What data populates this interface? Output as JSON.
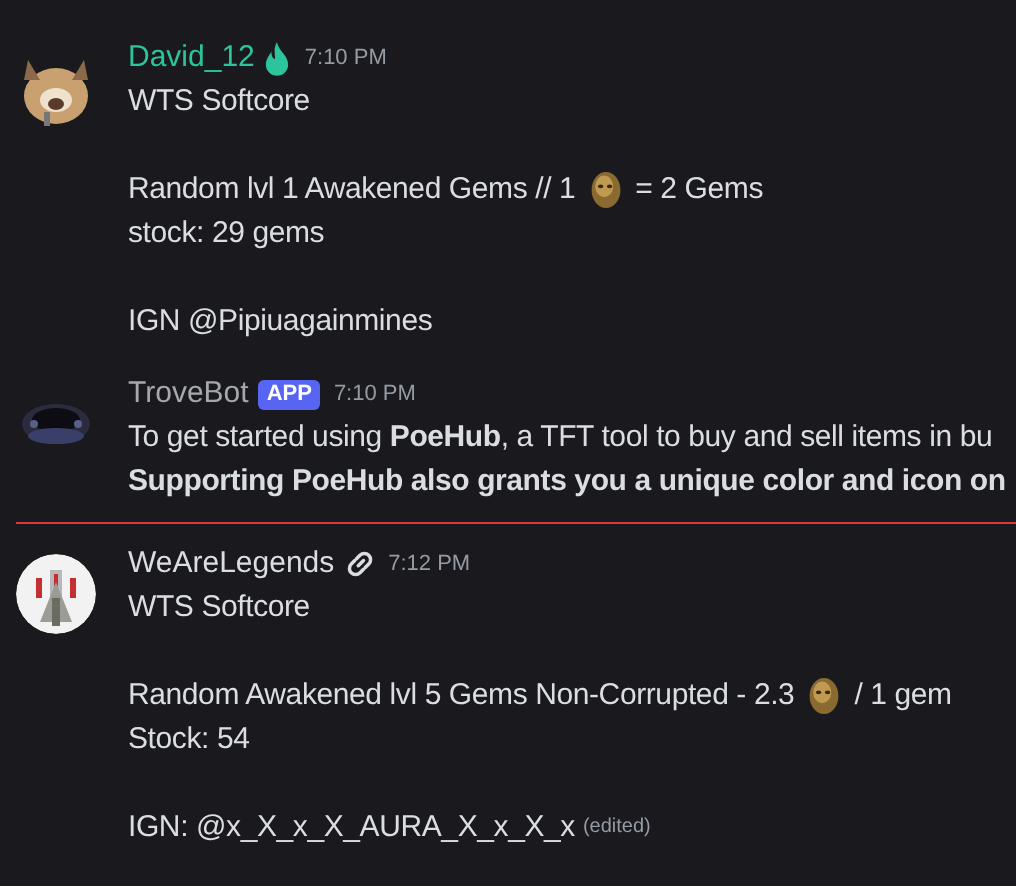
{
  "messages": [
    {
      "author": "David_12",
      "color": "#2bc49c",
      "kind": "flame",
      "time": "7:10 PM",
      "lines": [
        {
          "parts": [
            {
              "kind": "text",
              "text": "WTS Softcore"
            }
          ]
        },
        {
          "gap_before": true,
          "parts": [
            {
              "kind": "text",
              "text": "Random lvl 1 Awakened Gems // 1"
            },
            {
              "kind": "emoji"
            },
            {
              "kind": "text",
              "text": "= 2 Gems"
            }
          ]
        },
        {
          "parts": [
            {
              "kind": "text",
              "text": "stock: 29 gems"
            }
          ]
        },
        {
          "gap_before": true,
          "parts": [
            {
              "kind": "text",
              "text": "IGN @Pipiuagainmines"
            }
          ]
        }
      ]
    },
    {
      "author": "TroveBot",
      "color": "#a5a8ae",
      "kind": "app",
      "badge": "APP",
      "time": "7:10 PM",
      "lines": [
        {
          "parts": [
            {
              "kind": "text",
              "text": "To get started using **PoeHub**, a TFT tool to buy and sell items in bu"
            }
          ]
        },
        {
          "bold": true,
          "parts": [
            {
              "kind": "text",
              "text": "Supporting PoeHub also grants you a unique color and icon on"
            }
          ]
        }
      ]
    },
    {
      "new_divider": true,
      "author": "WeAreLegends",
      "color": "#dbdee1",
      "kind": "link",
      "time": "7:12 PM",
      "lines": [
        {
          "parts": [
            {
              "kind": "text",
              "text": "WTS Softcore"
            }
          ]
        },
        {
          "gap_before": true,
          "parts": [
            {
              "kind": "text",
              "text": "Random Awakened lvl 5 Gems Non-Corrupted - 2.3"
            },
            {
              "kind": "emoji"
            },
            {
              "kind": "text",
              "text": "/ 1 gem"
            }
          ]
        },
        {
          "parts": [
            {
              "kind": "text",
              "text": "Stock: 54"
            }
          ]
        },
        {
          "gap_before": true,
          "parts": [
            {
              "kind": "text",
              "text": "IGN: @x_X_x_X_AURA_X_x_X_x"
            }
          ],
          "edited": "(edited)"
        }
      ]
    }
  ]
}
